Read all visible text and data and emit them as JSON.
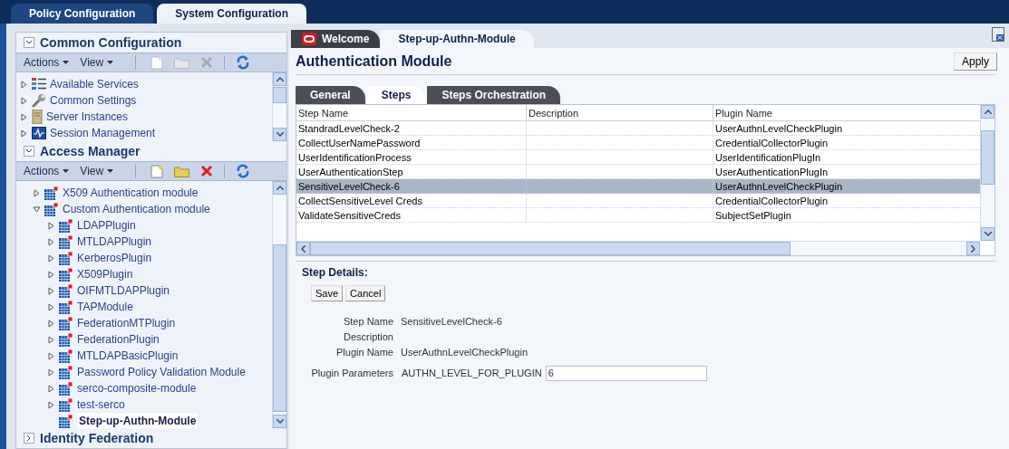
{
  "top_tabs": [
    {
      "label": "Policy Configuration",
      "selected": false
    },
    {
      "label": "System Configuration",
      "selected": true
    }
  ],
  "common_configuration": {
    "title": "Common Configuration",
    "expanded": true,
    "toolbar": {
      "actions": "Actions",
      "view": "View",
      "enabled": false
    },
    "items": [
      {
        "label": "Available Services",
        "kind": "services"
      },
      {
        "label": "Common Settings",
        "kind": "settings"
      },
      {
        "label": "Server Instances",
        "kind": "server"
      },
      {
        "label": "Session Management",
        "kind": "session"
      }
    ]
  },
  "access_manager": {
    "title": "Access Manager",
    "expanded": true,
    "toolbar": {
      "actions": "Actions",
      "view": "View",
      "enabled": true
    },
    "items": [
      {
        "label": "X509 Authentication module",
        "expanded": false,
        "selected": false,
        "kind": "node"
      },
      {
        "label": "Custom Authentication module",
        "expanded": true,
        "selected": false,
        "kind": "node",
        "children": [
          {
            "label": "LDAPPlugin",
            "expanded": false,
            "selected": false,
            "kind": "node"
          },
          {
            "label": "MTLDAPPlugin",
            "expanded": false,
            "selected": false,
            "kind": "node"
          },
          {
            "label": "KerberosPlugin",
            "expanded": false,
            "selected": false,
            "kind": "node"
          },
          {
            "label": "X509Plugin",
            "expanded": false,
            "selected": false,
            "kind": "node"
          },
          {
            "label": "OIFMTLDAPPlugin",
            "expanded": false,
            "selected": false,
            "kind": "node"
          },
          {
            "label": "TAPModule",
            "expanded": false,
            "selected": false,
            "kind": "node"
          },
          {
            "label": "FederationMTPlugin",
            "expanded": false,
            "selected": false,
            "kind": "node"
          },
          {
            "label": "FederationPlugin",
            "expanded": false,
            "selected": false,
            "kind": "node"
          },
          {
            "label": "MTLDAPBasicPlugin",
            "expanded": false,
            "selected": false,
            "kind": "node"
          },
          {
            "label": "Password Policy Validation Module",
            "expanded": false,
            "selected": false,
            "kind": "node"
          },
          {
            "label": "serco-composite-module",
            "expanded": false,
            "selected": false,
            "kind": "node"
          },
          {
            "label": "test-serco",
            "expanded": false,
            "selected": false,
            "kind": "node"
          },
          {
            "label": "Step-up-Authn-Module",
            "expanded": false,
            "selected": true,
            "kind": "leaf"
          }
        ]
      }
    ]
  },
  "identity_federation": {
    "title": "Identity Federation",
    "expanded": false
  },
  "doc_tabs": [
    {
      "label": "Welcome",
      "selected": false,
      "kind": "home"
    },
    {
      "label": "Step-up-Authn-Module",
      "selected": true,
      "kind": "page"
    }
  ],
  "page_title": "Authentication Module",
  "apply_button": "Apply",
  "sub_tabs": [
    {
      "label": "General",
      "selected": false
    },
    {
      "label": "Steps",
      "selected": true
    },
    {
      "label": "Steps Orchestration",
      "selected": false
    }
  ],
  "table": {
    "columns": [
      "Step Name",
      "Description",
      "Plugin Name"
    ],
    "rows": [
      {
        "step_name": "StandradLevelCheck-2",
        "plugin_name": "UserAuthnLevelCheckPlugin",
        "selected": false
      },
      {
        "step_name": "CollectUserNamePassword",
        "plugin_name": "CredentialCollectorPlugin",
        "selected": false
      },
      {
        "step_name": "UserIdentificationProcess",
        "plugin_name": "UserIdentificationPlugIn",
        "selected": false
      },
      {
        "step_name": "UserAuthenticationStep",
        "plugin_name": "UserAuthenticationPlugIn",
        "selected": false
      },
      {
        "step_name": "SensitiveLevelCheck-6",
        "plugin_name": "UserAuthnLevelCheckPlugin",
        "selected": true
      },
      {
        "step_name": "CollectSensitiveLevel Creds",
        "plugin_name": "CredentialCollectorPlugin",
        "selected": false
      },
      {
        "step_name": "ValidateSensitiveCreds",
        "plugin_name": "SubjectSetPlugin",
        "selected": false
      }
    ]
  },
  "step_details": {
    "title": "Step Details:",
    "buttons": [
      "Save",
      "Cancel"
    ],
    "fields": [
      {
        "label": "Step Name",
        "value": "SensitiveLevelCheck-6"
      },
      {
        "label": "Description"
      },
      {
        "label": "Plugin Name",
        "value": "UserAuthnLevelCheckPlugin"
      }
    ],
    "plugin_parameters": {
      "label": "Plugin Parameters",
      "name": "AUTHN_LEVEL_FOR_PLUGIN",
      "value": "6"
    }
  }
}
